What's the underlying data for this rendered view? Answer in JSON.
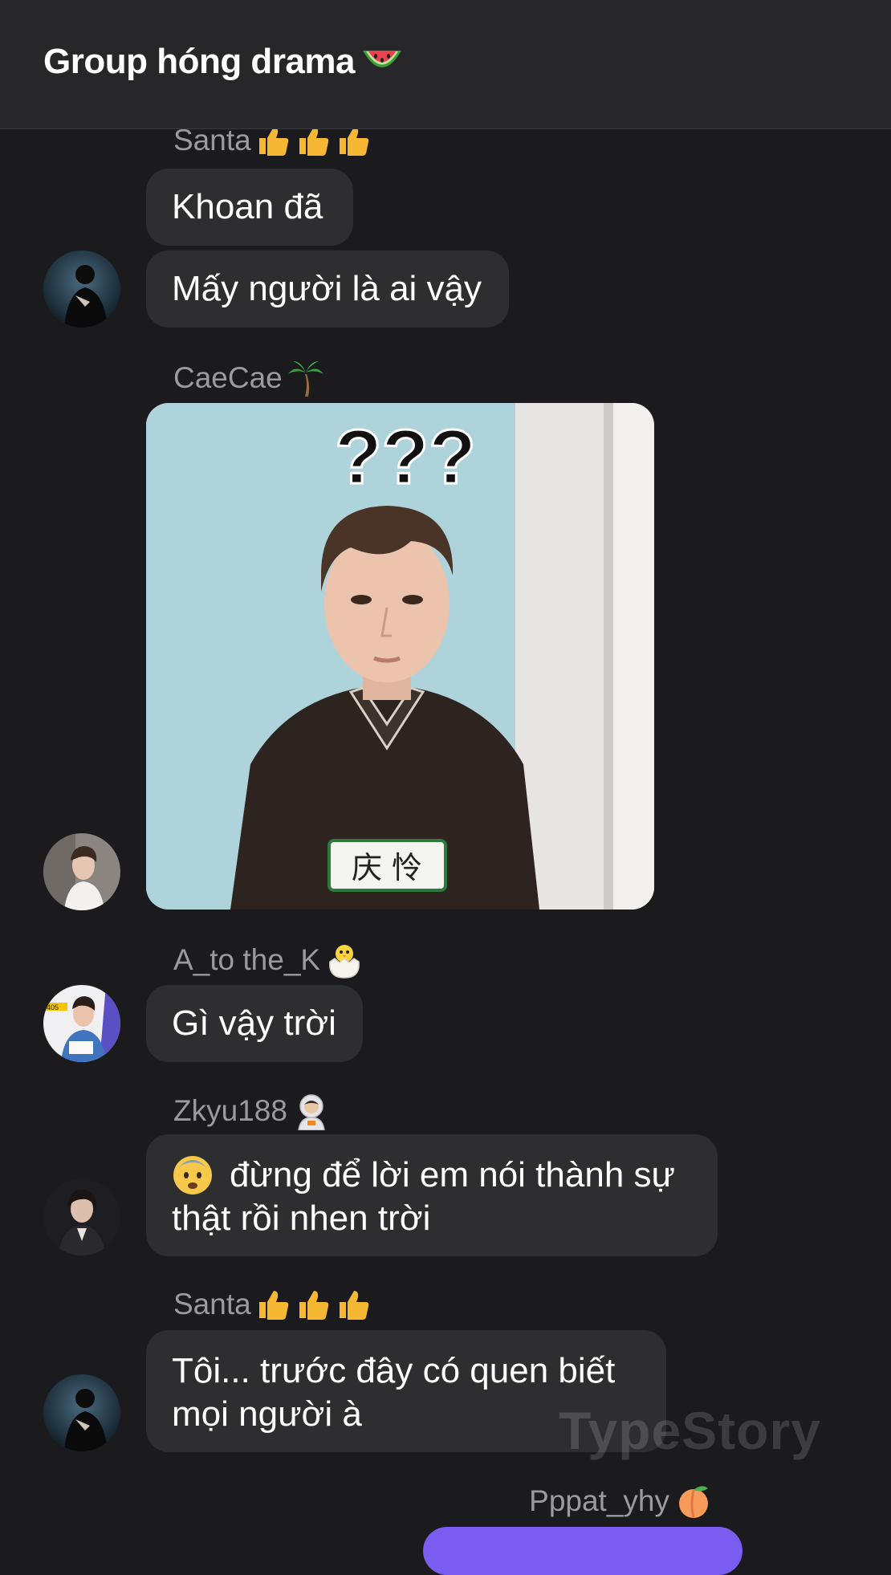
{
  "header": {
    "title": "Group hóng drama",
    "title_icon": "watermelon-icon"
  },
  "messages": [
    {
      "sender": "Santa",
      "sender_emoji": "thumbs-up-icon x3",
      "bubbles": [
        "Khoan đã",
        "Mấy người là ai vậy"
      ]
    },
    {
      "sender": "CaeCae",
      "sender_emoji": "palm-tree-icon",
      "image": "confused-boy-meme",
      "image_marks": "???",
      "badge_text": "庆 怜"
    },
    {
      "sender": "A_to the_K",
      "sender_emoji": "hatching-chick-icon",
      "bubbles": [
        "Gì vậy trời"
      ]
    },
    {
      "sender": "Zkyu188",
      "sender_emoji": "astronaut-icon",
      "bubbles": [
        "đừng để lời em nói thành sự",
        "thật rồi nhen trời"
      ],
      "lead_emoji": "fearful-face-icon"
    },
    {
      "sender": "Santa",
      "sender_emoji": "thumbs-up-icon x3",
      "bubbles": [
        "Tôi... trước đây có quen biết",
        "mọi người à"
      ]
    },
    {
      "sender": "Pppat_yhy",
      "sender_emoji": "peach-icon",
      "self": true
    }
  ],
  "watermark": "TypeStory",
  "colors": {
    "background": "#1b1b1d",
    "header": "#27272a",
    "bubble": "#2e2e31",
    "accent": "#7b5cf0",
    "name": "#9a9aa0"
  }
}
